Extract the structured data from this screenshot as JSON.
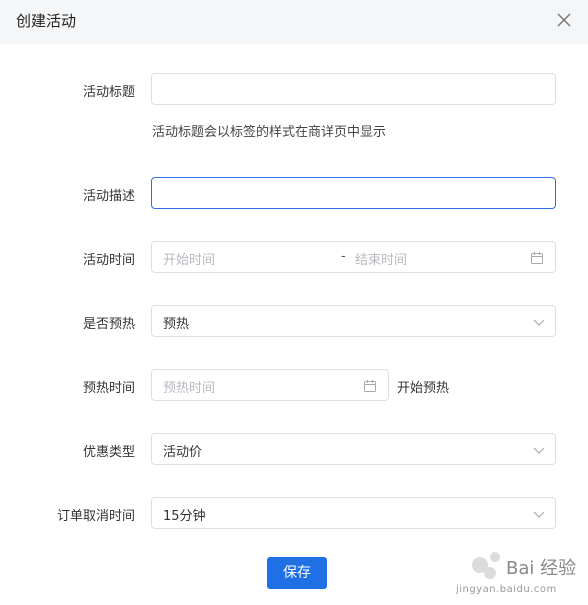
{
  "dialog": {
    "title": "创建活动"
  },
  "form": {
    "activity_title": {
      "label": "活动标题",
      "value": "",
      "placeholder": "",
      "hint": "活动标题会以标签的样式在商详页中显示"
    },
    "activity_desc": {
      "label": "活动描述",
      "value": "",
      "placeholder": ""
    },
    "activity_time": {
      "label": "活动时间",
      "start_placeholder": "开始时间",
      "separator": "-",
      "end_placeholder": "结束时间"
    },
    "preheat": {
      "label": "是否预热",
      "value": "预热"
    },
    "preheat_time": {
      "label": "预热时间",
      "placeholder": "预热时间",
      "suffix": "开始预热"
    },
    "discount_type": {
      "label": "优惠类型",
      "value": "活动价"
    },
    "cancel_time": {
      "label": "订单取消时间",
      "value": "15分钟"
    }
  },
  "actions": {
    "save_label": "保存"
  },
  "watermark": {
    "main": "Bai 经验",
    "sub": "jingyan.baidu.com"
  },
  "icons": {
    "close": "close-icon",
    "calendar": "calendar-icon",
    "chevron": "chevron-down-icon"
  },
  "colors": {
    "primary": "#1f6fe5",
    "focus_border": "#2f6fe6",
    "header_bg": "#f5f6f8"
  }
}
